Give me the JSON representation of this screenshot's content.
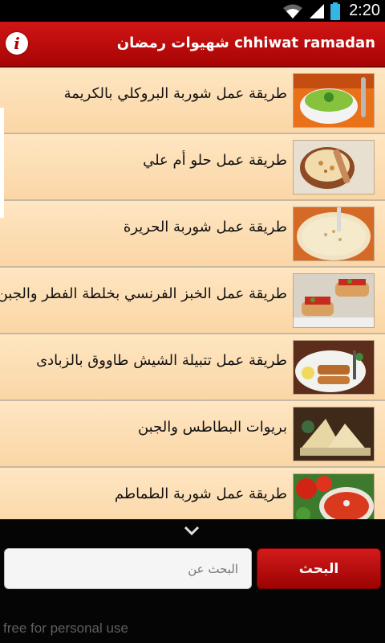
{
  "status_bar": {
    "time": "2:20"
  },
  "header": {
    "title": "شهيوات رمضان chhiwat ramadan",
    "info_button": "i"
  },
  "recipes": [
    {
      "label": "طريقة عمل شوربة البروكلي بالكريمة",
      "thumb": "broccoli-soup"
    },
    {
      "label": "طريقة عمل حلو أم علي",
      "thumb": "om-ali"
    },
    {
      "label": "طريقة عمل شوربة الحريرة",
      "thumb": "harira-soup"
    },
    {
      "label": "طريقة عمل الخبز الفرنسي بخلطة الفطر والجبن",
      "thumb": "french-bread"
    },
    {
      "label": "طريقة عمل تتبيلة الشيش طاووق بالزبادى",
      "thumb": "shish-tawook"
    },
    {
      "label": "بريوات البطاطس والجبن",
      "thumb": "briouats"
    },
    {
      "label": "طريقة عمل شوربة الطماطم",
      "thumb": "tomato-soup"
    }
  ],
  "search": {
    "placeholder": "البحث عن",
    "button_label": "البحث"
  },
  "footer": {
    "watermark": "free for personal use"
  }
}
